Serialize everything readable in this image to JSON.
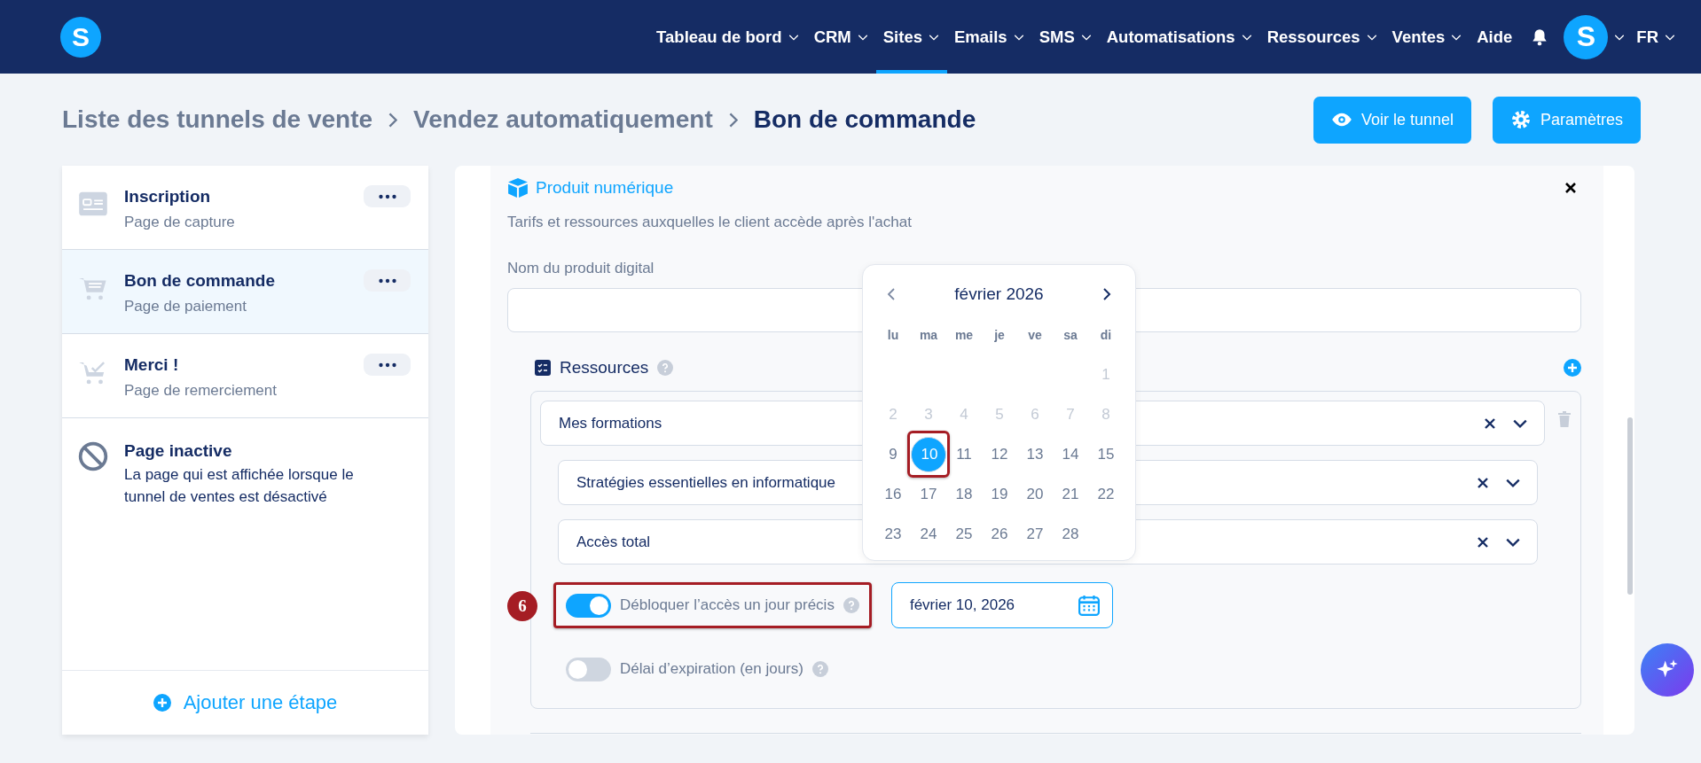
{
  "header": {
    "logo": "S",
    "nav": [
      {
        "label": "Tableau de bord",
        "dropdown": true,
        "selected": false
      },
      {
        "label": "CRM",
        "dropdown": true,
        "selected": false
      },
      {
        "label": "Sites",
        "dropdown": true,
        "selected": true
      },
      {
        "label": "Emails",
        "dropdown": true,
        "selected": false
      },
      {
        "label": "SMS",
        "dropdown": true,
        "selected": false
      },
      {
        "label": "Automatisations",
        "dropdown": true,
        "selected": false
      },
      {
        "label": "Ressources",
        "dropdown": true,
        "selected": false
      },
      {
        "label": "Ventes",
        "dropdown": true,
        "selected": false
      },
      {
        "label": "Aide",
        "dropdown": false,
        "selected": false
      }
    ],
    "avatar": "S",
    "language": "FR"
  },
  "breadcrumb": [
    "Liste des tunnels de vente",
    "Vendez automatiquement",
    "Bon de commande"
  ],
  "actions": [
    {
      "kind": "view",
      "label": "Voir le tunnel"
    },
    {
      "kind": "settings",
      "label": "Paramètres"
    }
  ],
  "sidebar": {
    "steps": [
      {
        "kind": "form",
        "title": "Inscription",
        "subtitle": "Page de capture",
        "selected": false
      },
      {
        "kind": "cart",
        "title": "Bon de commande",
        "subtitle": "Page de paiement",
        "selected": true
      },
      {
        "kind": "cart-check",
        "title": "Merci !",
        "subtitle": "Page de remerciement",
        "selected": false
      }
    ],
    "inactive": {
      "title": "Page inactive",
      "description": "La page qui est affichée lorsque le tunnel de ventes est désactivé"
    },
    "add_button": "Ajouter une étape"
  },
  "panel": {
    "title": "Produit numérique",
    "description": "Tarifs et ressources auxquelles le client accède après l'achat",
    "name_field": {
      "label": "Nom du produit digital"
    },
    "resources": {
      "title": "Ressources",
      "selects": [
        {
          "value": "Mes formations",
          "nested": false
        },
        {
          "value": "Stratégies essentielles en informatique",
          "nested": true
        },
        {
          "value": "Accès total",
          "nested": true
        }
      ],
      "toggles": [
        {
          "label": "Débloquer l’accès un jour précis",
          "on": true,
          "highlighted": true,
          "date": "février 10, 2026"
        },
        {
          "label": "Délai d’expiration (en jours)",
          "on": false,
          "highlighted": false
        }
      ]
    }
  },
  "calendar": {
    "month": "février 2026",
    "weekdays": [
      "lu",
      "ma",
      "me",
      "je",
      "ve",
      "sa",
      "di"
    ],
    "weeks": [
      [
        {
          "kind": "blank"
        },
        {
          "kind": "blank"
        },
        {
          "kind": "blank"
        },
        {
          "kind": "blank"
        },
        {
          "kind": "blank"
        },
        {
          "kind": "blank"
        },
        {
          "kind": "day",
          "day": "1",
          "disabled": true,
          "selected": false,
          "highlighted": false
        }
      ],
      [
        {
          "day": "2",
          "disabled": true,
          "selected": false,
          "highlighted": false
        },
        {
          "day": "3",
          "disabled": true,
          "selected": false,
          "highlighted": false
        },
        {
          "day": "4",
          "disabled": true,
          "selected": false,
          "highlighted": false
        },
        {
          "day": "5",
          "disabled": true,
          "selected": false,
          "highlighted": false
        },
        {
          "day": "6",
          "disabled": true,
          "selected": false,
          "highlighted": false
        },
        {
          "day": "7",
          "disabled": true,
          "selected": false,
          "highlighted": false
        },
        {
          "day": "8",
          "disabled": true,
          "selected": false,
          "highlighted": false
        }
      ],
      [
        {
          "day": "9",
          "disabled": false,
          "selected": false,
          "highlighted": false
        },
        {
          "day": "10",
          "disabled": false,
          "selected": true,
          "highlighted": true
        },
        {
          "day": "11",
          "disabled": false,
          "selected": false,
          "highlighted": false
        },
        {
          "day": "12",
          "disabled": false,
          "selected": false,
          "highlighted": false
        },
        {
          "day": "13",
          "disabled": false,
          "selected": false,
          "highlighted": false
        },
        {
          "day": "14",
          "disabled": false,
          "selected": false,
          "highlighted": false
        },
        {
          "day": "15",
          "disabled": false,
          "selected": false,
          "highlighted": false
        }
      ],
      [
        {
          "day": "16",
          "disabled": false,
          "selected": false,
          "highlighted": false
        },
        {
          "day": "17",
          "disabled": false,
          "selected": false,
          "highlighted": false
        },
        {
          "day": "18",
          "disabled": false,
          "selected": false,
          "highlighted": false
        },
        {
          "day": "19",
          "disabled": false,
          "selected": false,
          "highlighted": false
        },
        {
          "day": "20",
          "disabled": false,
          "selected": false,
          "highlighted": false
        },
        {
          "day": "21",
          "disabled": false,
          "selected": false,
          "highlighted": false
        },
        {
          "day": "22",
          "disabled": false,
          "selected": false,
          "highlighted": false
        }
      ],
      [
        {
          "day": "23",
          "disabled": false,
          "selected": false,
          "highlighted": false
        },
        {
          "day": "24",
          "disabled": false,
          "selected": false,
          "highlighted": false
        },
        {
          "day": "25",
          "disabled": false,
          "selected": false,
          "highlighted": false
        },
        {
          "day": "26",
          "disabled": false,
          "selected": false,
          "highlighted": false
        },
        {
          "day": "27",
          "disabled": false,
          "selected": false,
          "highlighted": false
        },
        {
          "day": "28",
          "disabled": false,
          "selected": false,
          "highlighted": false
        },
        {
          "kind": "blank"
        }
      ]
    ]
  },
  "annotation": {
    "badge": "6"
  }
}
